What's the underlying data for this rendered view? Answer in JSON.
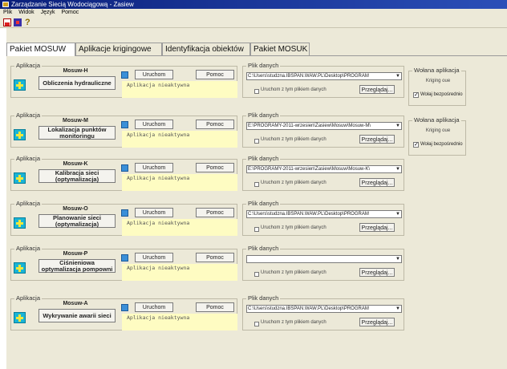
{
  "window": {
    "title": "Zarządzanie Siecią Wodociągową - Zasiew"
  },
  "menu": [
    "Plik",
    "Widok",
    "Język",
    "Pomoc"
  ],
  "tabs": [
    "Pakiet MOSUW",
    "Aplikacje krigingowe",
    "Identyfikacja obiektów",
    "Pakiet MOSUK"
  ],
  "labels": {
    "group_app": "Aplikacja",
    "group_file": "Plik danych",
    "run": "Uruchom",
    "help": "Pomoc",
    "browse": "Przeglądaj...",
    "run_with_file": "Uruchom z tym plikiem danych",
    "status": "Aplikacja nieaktywna",
    "wolana": "Wołana aplikacja",
    "kriging_sub": "Kriging oue",
    "call_direct": "Wołaj bezpośrednio"
  },
  "apps": [
    {
      "name": "Mosuw-H",
      "button": "Obliczenia hydrauliczne",
      "file": "C:\\Users\\studzna.IBSPAN.WAW.PL\\Desktop\\PROGRAM",
      "icon": "hydraulics-icon"
    },
    {
      "name": "Mosuw-M",
      "button": "Lokalizacja punktów monitoringu",
      "file": "E:\\PROGRAMY-2011-wrzesien\\Zasiew\\Mosuw\\Mosuw-M\\",
      "icon": "monitoring-icon"
    },
    {
      "name": "Mosuw-K",
      "button": "Kalibracja sieci (optymalizacja)",
      "file": "E:\\PROGRAMY-2011-wrzesien\\Zasiew\\Mosuw\\Mosuw-K\\",
      "icon": "calibration-icon"
    },
    {
      "name": "Mosuw-O",
      "button": "Planowanie sieci (optymalizacja)",
      "file": "C:\\Users\\studzna.IBSPAN.WAW.PL\\Desktop\\PROGRAM",
      "icon": "planning-icon"
    },
    {
      "name": "Mosuw-P",
      "button": "Ciśnieniowa optymalizacja pompowni",
      "file": "",
      "icon": "pump-icon"
    },
    {
      "name": "Mosuw-A",
      "button": "Wykrywanie awarii sieci",
      "file": "C:\\Users\\studzna.IBSPAN.WAW.PL\\Desktop\\PROGRAM",
      "icon": "failure-icon"
    }
  ],
  "wolana_checked": "✓"
}
